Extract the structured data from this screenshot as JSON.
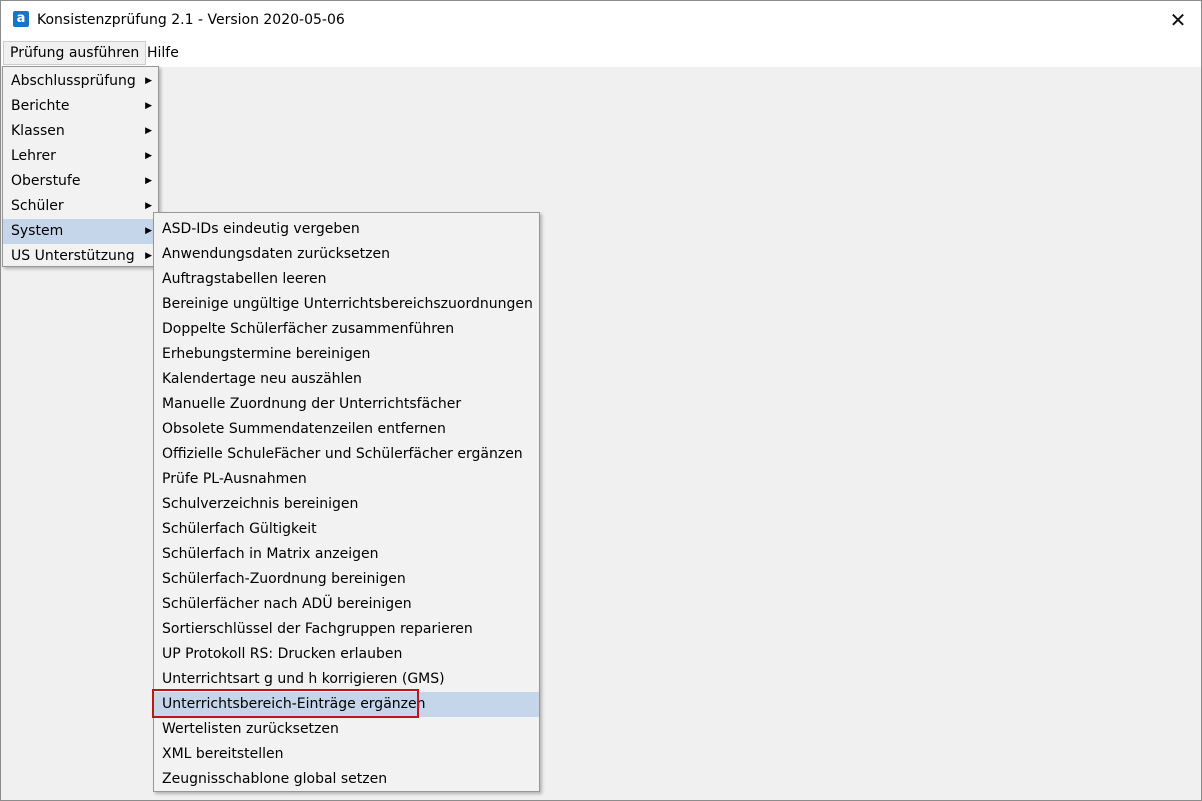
{
  "window": {
    "title": "Konsistenzprüfung 2.1 - Version 2020-05-06",
    "app_icon_letter": "a",
    "close_glyph": "✕"
  },
  "menubar": {
    "items": [
      "Prüfung ausführen",
      "Hilfe"
    ]
  },
  "main_menu": {
    "items": [
      {
        "label": "Abschlussprüfung",
        "submenu": true
      },
      {
        "label": "Berichte",
        "submenu": true
      },
      {
        "label": "Klassen",
        "submenu": true
      },
      {
        "label": "Lehrer",
        "submenu": true
      },
      {
        "label": "Oberstufe",
        "submenu": true
      },
      {
        "label": "Schüler",
        "submenu": true
      },
      {
        "label": "System",
        "submenu": true,
        "highlighted": true
      },
      {
        "label": "US Unterstützung",
        "submenu": true
      }
    ],
    "arrow_glyph": "▶"
  },
  "system_submenu": {
    "items": [
      "ASD-IDs eindeutig vergeben",
      "Anwendungsdaten zurücksetzen",
      "Auftragstabellen leeren",
      "Bereinige ungültige Unterrichtsbereichszuordnungen",
      "Doppelte Schülerfächer zusammenführen",
      "Erhebungstermine bereinigen",
      "Kalendertage neu auszählen",
      "Manuelle Zuordnung der Unterrichtsfächer",
      "Obsolete Summendatenzeilen entfernen",
      "Offizielle SchuleFächer und Schülerfächer ergänzen",
      "Prüfe PL-Ausnahmen",
      "Schulverzeichnis bereinigen",
      "Schülerfach Gültigkeit",
      "Schülerfach in Matrix anzeigen",
      "Schülerfach-Zuordnung bereinigen",
      "Schülerfächer nach ADÜ bereinigen",
      "Sortierschlüssel der Fachgruppen reparieren",
      "UP Protokoll RS: Drucken erlauben",
      "Unterrichtsart g und h korrigieren (GMS)",
      "Unterrichtsbereich-Einträge ergänzen",
      "Wertelisten zurücksetzen",
      "XML bereitstellen",
      "Zeugnisschablone global setzen"
    ],
    "highlighted_item": "Unterrichtsbereich-Einträge ergänzen"
  },
  "colors": {
    "menu_highlight": "#c5d5ea",
    "annotation_box": "#c0141b",
    "app_icon": "#1a73c8"
  }
}
